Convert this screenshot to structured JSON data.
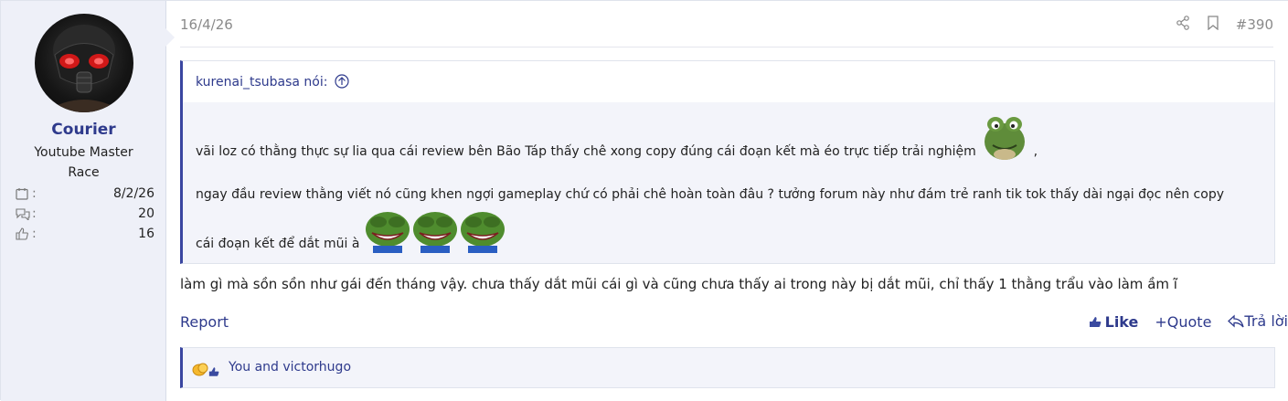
{
  "user": {
    "name": "Courier",
    "title": "Youtube Master Race",
    "stats": [
      {
        "icon": "calendar-icon",
        "value": "8/2/26"
      },
      {
        "icon": "messages-icon",
        "value": "20"
      },
      {
        "icon": "reaction-score-icon",
        "value": "16"
      }
    ]
  },
  "post": {
    "date": "16/4/26",
    "number": "#390",
    "quote": {
      "author": "kurenai_tsubasa nói:",
      "line1": "vãi loz có thằng thực sự lia qua cái review bên Bão Táp thấy chê xong copy đúng cái đoạn kết mà éo trực tiếp trải nghiệm",
      "line1_tail": ",",
      "line2": "ngay đầu review thằng viết nó cũng khen ngợi gameplay chứ có phải chê hoàn toàn đâu ? tưởng forum này như đám trẻ ranh tik tok thấy dài ngại đọc nên copy",
      "line3": "cái đoạn kết để dắt mũi à"
    },
    "body": "làm gì mà sồn sồn như gái đến tháng vậy. chưa thấy dắt mũi cái gì và cũng chưa thấy ai trong này bị dắt mũi, chỉ thấy 1 thằng trẩu vào làm ầm ĩ",
    "report_label": "Report",
    "like_label": "Like",
    "quote_label": "+Quote",
    "reply_label": "Trả lời",
    "reactions_text": "You and victorhugo"
  },
  "colors": {
    "accent": "#2e3a8c",
    "sidebar_bg": "#eef0f8",
    "quote_border": "#3a46a0"
  }
}
